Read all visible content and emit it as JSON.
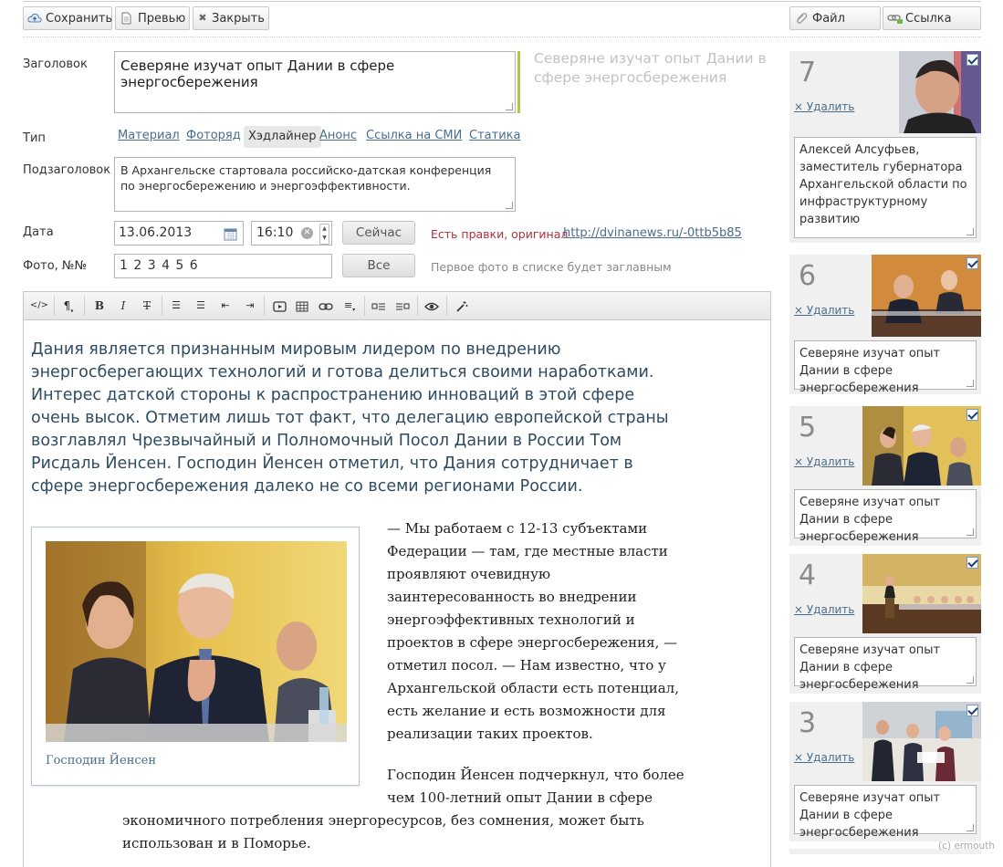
{
  "toolbar": {
    "save_label": "Сохранить",
    "preview_label": "Превью",
    "close_label": "Закрыть",
    "file_label": "Файл",
    "link_label": "Ссылка"
  },
  "form": {
    "title_label": "Заголовок",
    "title_value": "Северяне изучат опыт Дании в сфере энергосбережения",
    "title_preview": "Северяне изучат опыт Дании в сфере энергосбережения",
    "type_label": "Тип",
    "types": [
      "Материал",
      "Фоторяд",
      "Хэдлайнер",
      "Анонс",
      "Ссылка на СМИ",
      "Статика"
    ],
    "type_selected": "Хэдлайнер",
    "subtitle_label": "Подзаголовок",
    "subtitle_value": "В Архангельске стартовала российско-датская конференция по энергосбережению и энергоэффективности.",
    "date_label": "Дата",
    "date_value": "13.06.2013",
    "time_value": "16:10",
    "now_button": "Сейчас",
    "edits_note": "Есть правки, оригинал",
    "edits_link": "http://dvinanews.ru/-0ttb5b85",
    "photos_label": "Фото, №№",
    "photos_value": "1 2 3 4 5 6",
    "all_button": "Все",
    "photos_hint": "Первое фото в списке будет заглавным"
  },
  "editor": {
    "lead": "Дания является признанным мировым лидером по внедрению энергосберегающих технологий и готова делиться своими наработками. Интерес датской стороны к распространению инноваций в этой сфере очень высок. Отметим лишь тот факт, что делегацию европейской страны возглавлял Чрезвычайный и Полномочный Посол Дании в России Том Рисдаль Йенсен. Господин Йенсен отметил, что Дания сотрудничает в сфере энергосбережения далеко не со всеми регионами России.",
    "figure_caption": "Господин Йенсен",
    "para1": "— Мы работаем с 12-13 субъектами Федерации — там, где местные власти проявляют очевидную заинтересованность во внедрении энергоэффективных технологий и проектов в сфере энергосбережения, — отметил посол. — Нам известно, что у Архангельской области есть потенциал, есть желание и есть возможности для реализации таких проектов.",
    "para2": "Господин Йенсен подчеркнул, что более чем 100-летний опыт Дании в сфере",
    "para3": "экономичного потребления энергоресурсов, без сомнения, может быть использован и в Поморье."
  },
  "photos": {
    "delete_label": "× Удалить",
    "items": [
      {
        "num": "7",
        "caption": "Алексей Алсуфьев, заместитель губернатора Архангельской области по инфраструктурному развитию"
      },
      {
        "num": "6",
        "caption": "Северяне изучат опыт Дании в сфере энергосбережения"
      },
      {
        "num": "5",
        "caption": "Северяне изучат опыт Дании в сфере энергосбережения"
      },
      {
        "num": "4",
        "caption": "Северяне изучат опыт Дании в сфере энергосбережения"
      },
      {
        "num": "3",
        "caption": "Северяне изучат опыт Дании в сфере энергосбережения"
      }
    ]
  },
  "footer": {
    "copyright": "(c) ermouth"
  },
  "colors": {
    "accent_link": "#4a6d8d",
    "edits_note": "#b0303a",
    "title_bar": "#a6d13c"
  }
}
